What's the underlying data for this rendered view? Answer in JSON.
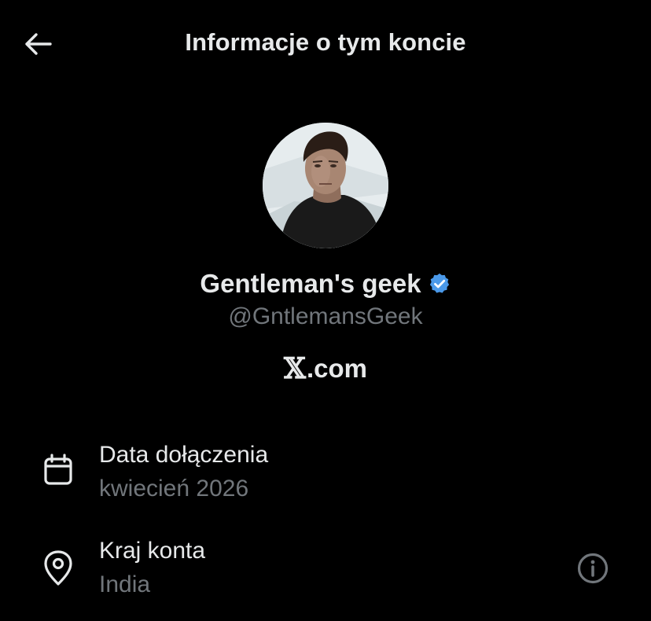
{
  "header": {
    "title": "Informacje o tym koncie",
    "back_icon": "arrow-left-icon"
  },
  "profile": {
    "display_name": "Gentleman's geek",
    "verified_icon": "verified-badge-icon",
    "verified_color": "#4a99e9",
    "handle": "@GntlemansGeek",
    "site_prefix": "𝕏",
    "site_suffix": ".com"
  },
  "details": [
    {
      "icon": "calendar-icon",
      "label": "Data dołączenia",
      "value": "kwiecień 2026"
    },
    {
      "icon": "location-pin-icon",
      "label": "Kraj konta",
      "value": "India",
      "action_icon": "info-circle-icon"
    }
  ],
  "colors": {
    "background": "#000000",
    "primary_text": "#e7e9ea",
    "secondary_text": "#71767b"
  }
}
